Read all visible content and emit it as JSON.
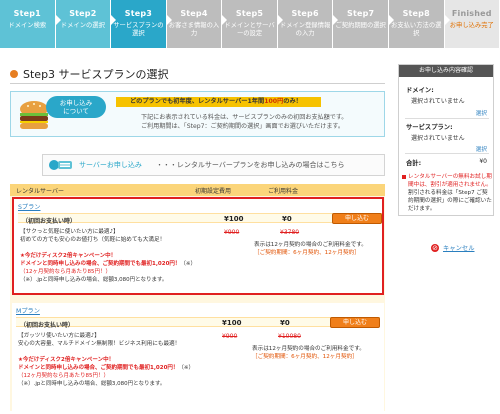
{
  "steps": [
    {
      "num": "Step1",
      "label": "ドメイン検索"
    },
    {
      "num": "Step2",
      "label": "ドメインの選択"
    },
    {
      "num": "Step3",
      "label": "サービスプランの選択"
    },
    {
      "num": "Step4",
      "label": "お客さま情報の入力"
    },
    {
      "num": "Step5",
      "label": "ドメインとサーバーの設定"
    },
    {
      "num": "Step6",
      "label": "ドメイン登録情報の入力"
    },
    {
      "num": "Step7",
      "label": "ご契約期間の選択"
    },
    {
      "num": "Step8",
      "label": "お支払い方法の選択"
    },
    {
      "num": "Finished",
      "label": "お申し込み完了"
    }
  ],
  "page_title": "Step3 サービスプランの選択",
  "promo": {
    "badge_line1": "お申し込み",
    "badge_line2": "について",
    "banner_prefix": "どのプランでも初年度、レンタルサーバー1年間",
    "banner_highlight": "100円",
    "banner_suffix": "のみ！",
    "note_line1": "下記にお表示されている料金は、サービスプランのみの初回お支払額です。",
    "note_line2": "ご利用期間は、「Step7：ご契約期間の選択」画面でお選びいただけます。"
  },
  "apply_bar": {
    "link": "サーバーお申し込み",
    "desc": "・・・レンタルサーバープランをお申し込みの場合はこちら"
  },
  "table_head": {
    "col1": "レンタルサーバー",
    "col2": "初期設定費用",
    "col3": "ご利用料金"
  },
  "plans": [
    {
      "name": "Sプラン",
      "billing": "（初回お支払い時）",
      "setup_price": "¥100",
      "usage_price": "¥0",
      "setup_strike": "¥900",
      "usage_strike": "¥3780",
      "button": "申し込む",
      "desc_line1": "【サクっと気軽に使いたい方に最適♪】",
      "desc_line2": "初めての方でも安心のお値打ち（気軽に始めても大満足！",
      "campaign": "★今だけディスク2倍キャンペーン中！",
      "domain_offer": "ドメインと同時申し込みの場合、ご契約期間でも最初1,020円！",
      "domain_offer_suffix": "（※）",
      "offer_note": "（12ヶ月契約なら月あたり85円！）",
      "jp_note": "（※）.jpと同時申し込みの場合、総額3,080円となります。",
      "right_note1": "表示は12ヶ月契約の場合のご利用料金です。",
      "right_note2": "［ご契約期間：6ヶ月契約、12ヶ月契約］"
    },
    {
      "name": "Mプラン",
      "billing": "（初回お支払い時）",
      "setup_price": "¥100",
      "usage_price": "¥0",
      "setup_strike": "¥900",
      "usage_strike": "¥10080",
      "button": "申し込む",
      "desc_line1": "【ガッツリ使いたい方に最適♪】",
      "desc_line2": "安心の大容量、マルチドメイン無制限！ビジネス利用にも最適！",
      "campaign": "★今だけディスク2倍キャンペーン中！",
      "domain_offer": "ドメインと同時申し込みの場合、ご契約期間でも最初1,020円！",
      "domain_offer_suffix": "（※）",
      "offer_note": "（12ヶ月契約なら月あたり85円！）",
      "jp_note": "（※）.jpと同時申し込みの場合、総額3,080円となります。",
      "right_note1": "表示は12ヶ月契約の場合のご利用料金です。",
      "right_note2": "［ご契約期間：6ヶ月契約、12ヶ月契約］"
    }
  ],
  "sidebar": {
    "title": "お申し込み内容確認",
    "domain_label": "ドメイン:",
    "domain_value": "選択されていません",
    "domain_link": "選択",
    "plan_label": "サービスプラン:",
    "plan_value": "選択されていません",
    "plan_link": "選択",
    "total_label": "合計:",
    "total_value": "¥0",
    "warn_red": "レンタルサーバーの無料お試し期間中は、割引が適用されません。",
    "warn_plain": "割引される料金は「Step7 ご契約期間の選択」の際にご確認いただけます。",
    "cancel": "キャンセル"
  },
  "colors": {
    "accent": "#2aa7c9",
    "step_done": "#5ec2d6",
    "orange": "#f07f1a",
    "red": "#e02020",
    "table_head": "#fbd57a"
  }
}
